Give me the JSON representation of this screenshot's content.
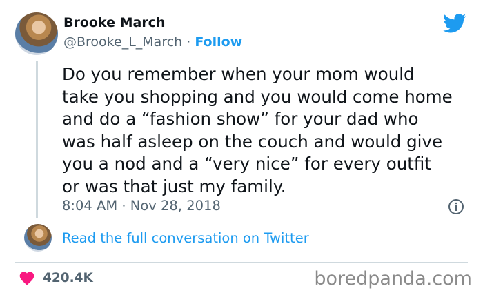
{
  "author": {
    "name": "Brooke March",
    "handle": "@Brooke_L_March",
    "separator": " · ",
    "follow_label": "Follow"
  },
  "tweet": {
    "text": "Do you remember when your mom would\ntake you shopping and you would come home\nand do a “fashion show” for your dad who\nwas half asleep on the couch and would give\nyou a nod and a “very nice” for every outfit\nor was that just my family.",
    "time": "8:04 AM",
    "date_separator": " · ",
    "date": "Nov 28, 2018"
  },
  "conversation": {
    "link_label": "Read the full conversation on Twitter"
  },
  "engagement": {
    "likes": "420.4K"
  },
  "watermark": "boredpanda.com",
  "icons": {
    "brand": "twitter-bird-icon",
    "info": "info-icon",
    "like": "heart-icon"
  },
  "colors": {
    "accent": "#1d9bf0",
    "like": "#f91880",
    "muted": "#536471"
  }
}
